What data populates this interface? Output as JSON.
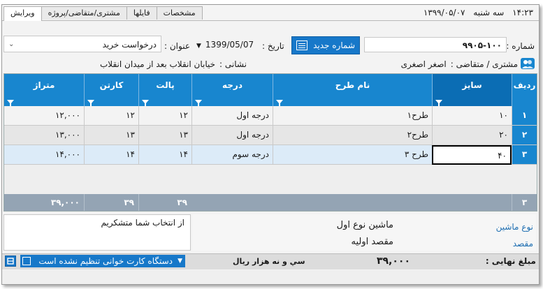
{
  "header": {
    "time": "۱۴:۲۳",
    "weekday": "سه شنبه",
    "date": "۱۳۹۹/۰۵/۰۷",
    "tabs": [
      {
        "label": "ویرایش"
      },
      {
        "label": "مشتری/متقاضی/پروژه"
      },
      {
        "label": "فایلها"
      },
      {
        "label": "مشخصات"
      }
    ]
  },
  "form": {
    "number_label": "شماره :",
    "number_value": "۹۹۰۵-۱۰۰",
    "new_number_button": "شماره جدید",
    "date_label": "تاریخ :",
    "date_value": "1399/05/07",
    "title_label": "عنوان :",
    "title_value": "درخواست خرید",
    "customer_label": "مشتری / متقاضی :",
    "customer_value": "اصغر اصغری",
    "address_label": "نشانی :",
    "address_value": "خیابان انقلاب بعد از میدان انقلاب"
  },
  "grid": {
    "columns": [
      {
        "label": "ردیف"
      },
      {
        "label": "سایز"
      },
      {
        "label": "نام طرح"
      },
      {
        "label": "درجه"
      },
      {
        "label": "پالت"
      },
      {
        "label": "کارتن"
      },
      {
        "label": "متراژ"
      }
    ],
    "rows": [
      {
        "no": "۱",
        "size": "۱۰",
        "design": "طرح۱",
        "grade": "درجه اول",
        "pallet": "۱۲",
        "carton": "۱۲",
        "meter": "۱۲,۰۰۰"
      },
      {
        "no": "۲",
        "size": "۲۰",
        "design": "طرح۲",
        "grade": "درجه اول",
        "pallet": "۱۳",
        "carton": "۱۳",
        "meter": "۱۳,۰۰۰"
      },
      {
        "no": "۳",
        "size": "۴۰",
        "design": "طرح ۳",
        "grade": "درجه سوم",
        "pallet": "۱۴",
        "carton": "۱۴",
        "meter": "۱۴,۰۰۰"
      }
    ],
    "summary": {
      "rows": "۳",
      "pallet": "۳۹",
      "carton": "۳۹",
      "meter": "۳۹,۰۰۰"
    }
  },
  "details": {
    "machine_type_label": "نوع ماشین",
    "machine_type_value": "ماشین نوع اول",
    "destination_label": "مقصد",
    "destination_value": "مقصد اولیه",
    "note_text": "از انتخاب شما متشکریم"
  },
  "footer": {
    "final_amount_label": "مبلغ نهایی :",
    "final_amount_value": "۳۹,۰۰۰",
    "amount_in_words": "سي و نه هزار  ريال",
    "card_reader_status": "دستگاه کارت خوانی تنظیم نشده است"
  },
  "colors": {
    "accent": "#1886cf",
    "summary": "#94a4b4",
    "link": "#1f6fb2"
  }
}
